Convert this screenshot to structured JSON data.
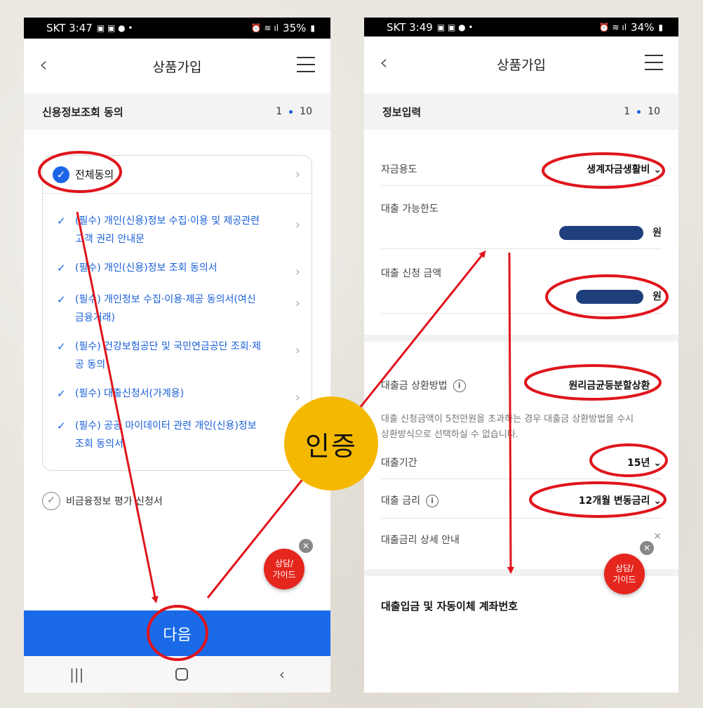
{
  "left_screen": {
    "status": {
      "carrier_time": "SKT 3:47",
      "battery": "35%"
    },
    "header": {
      "title": "상품가입"
    },
    "step": {
      "label": "신용정보조회 동의",
      "current": "1",
      "total": "10"
    },
    "agree_all": {
      "label": "전체동의"
    },
    "terms": [
      {
        "line1": "(필수) 개인(신용)정보 수집·이용 및 제공관련",
        "line2": "고객 권리 안내문"
      },
      {
        "line1": "(필수) 개인(신용)정보 조회 동의서",
        "line2": ""
      },
      {
        "line1": "(필수) 개인정보 수집·이용·제공 동의서(여신",
        "line2": "금융거래)"
      },
      {
        "line1": "(필수) 건강보험공단 및 국민연금공단 조회·제",
        "line2": "공 동의"
      },
      {
        "line1": "(필수) 대출신청서(가계용)",
        "line2": ""
      },
      {
        "line1": "(필수) 공공 마이데이터 관련 개인(신용)정보",
        "line2": "조회 동의서"
      }
    ],
    "extra_option": {
      "label": "비금융정보 평가 신청서"
    },
    "consult": {
      "line1": "상담/",
      "line2": "가이드"
    },
    "next_button": "다음"
  },
  "right_screen": {
    "status": {
      "carrier_time": "SKT 3:49",
      "battery": "34%"
    },
    "header": {
      "title": "상품가입"
    },
    "step": {
      "label": "정보입력",
      "current": "1",
      "total": "10"
    },
    "fund_purpose": {
      "label": "자금용도",
      "value": "생계자금생활비"
    },
    "loan_limit": {
      "label": "대출 가능한도",
      "unit": "원"
    },
    "loan_amount": {
      "label": "대출 신청 금액",
      "unit": "원"
    },
    "repayment": {
      "label": "대출금 상환방법",
      "value": "원리금균등분할상환"
    },
    "note": {
      "line1": "대출 신청금액이 5천만원을 초과하는 경우 대출금 상환방법을 수시",
      "line2": "상환방식으로 선택하실 수 없습니다."
    },
    "term": {
      "label": "대출기간",
      "value": "15년"
    },
    "rate": {
      "label": "대출 금리",
      "value": "12개월 변동금리"
    },
    "rate_detail": {
      "label": "대출금리 상세 안내"
    },
    "account_section": {
      "title": "대출입금 및 자동이체 계좌번호"
    },
    "consult": {
      "line1": "상담/",
      "line2": "가이드"
    }
  },
  "annotation": {
    "badge": "인증",
    "accent_red": "#e0141c",
    "badge_color": "#f4b800"
  }
}
